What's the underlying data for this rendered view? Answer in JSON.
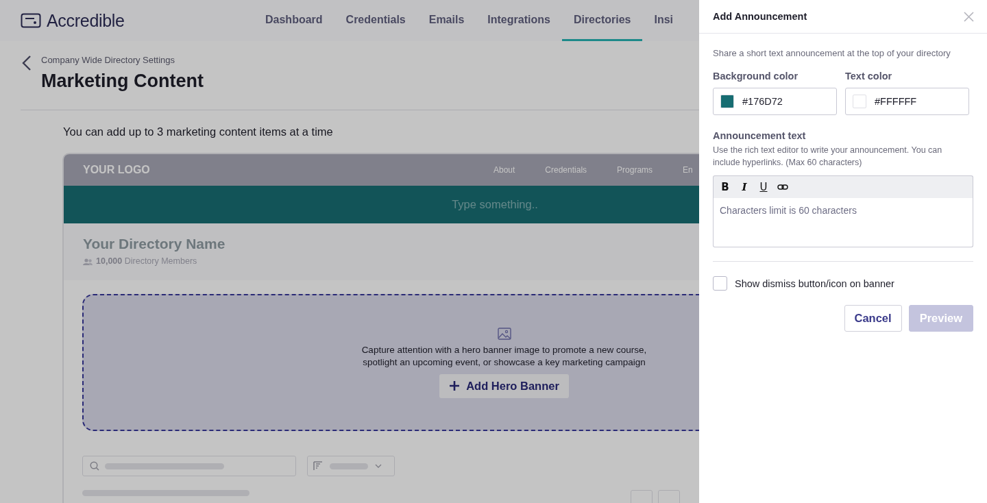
{
  "app": {
    "brand": "Accredible"
  },
  "nav": [
    {
      "label": "Dashboard",
      "selected": false
    },
    {
      "label": "Credentials",
      "selected": false
    },
    {
      "label": "Emails",
      "selected": false
    },
    {
      "label": "Integrations",
      "selected": false
    },
    {
      "label": "Directories",
      "selected": true
    },
    {
      "label": "Insi",
      "selected": false
    }
  ],
  "page": {
    "breadcrumb": "Company Wide Directory Settings",
    "title": "Marketing Content",
    "intro": "You can add up to 3 marketing content items at a time"
  },
  "preview": {
    "logo": "YOUR LOGO",
    "nav": [
      "About",
      "Credentials",
      "Programs",
      "En"
    ],
    "banner_text": "Type something..",
    "directory_name": "Your Directory Name",
    "member_count": "10,000",
    "members_label": "Directory Members",
    "hero": {
      "description": "Capture attention with a hero banner image to promote a new course, spotlight an upcoming event, or showcase a key marketing campaign",
      "button": "Add Hero Banner"
    }
  },
  "panel": {
    "title": "Add Announcement",
    "intro": "Share a short text announcement at the top of your directory",
    "colors": [
      {
        "label": "Background color",
        "value": "#176D72"
      },
      {
        "label": "Text color",
        "value": "#FFFFFF"
      }
    ],
    "announcement": {
      "label": "Announcement text",
      "help": "Use the rich text editor to write your announcement. You can include hyperlinks. (Max 60 characters)",
      "toolbar": [
        "B",
        "I",
        "U"
      ],
      "placeholder": "Characters limit is 60 characters"
    },
    "dismiss": {
      "label": "Show dismiss button/icon on banner",
      "checked": false
    },
    "buttons": [
      {
        "label": "Cancel",
        "disabled": false
      },
      {
        "label": "Preview",
        "disabled": true
      }
    ]
  }
}
